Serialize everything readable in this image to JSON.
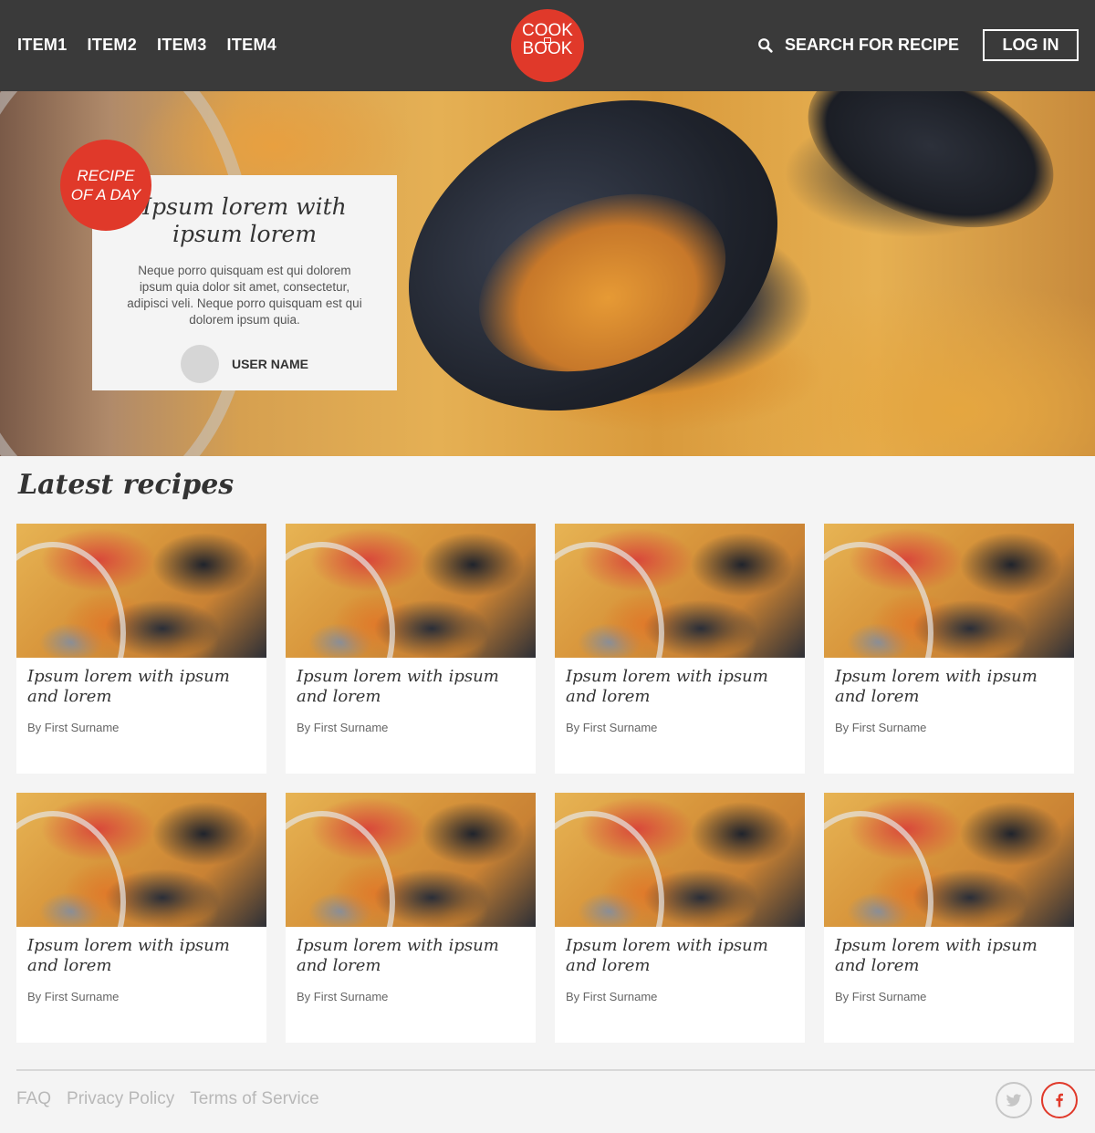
{
  "header": {
    "nav": [
      "ITEM1",
      "ITEM2",
      "ITEM3",
      "ITEM4"
    ],
    "logo_top": "COOK",
    "logo_bottom": "BOOK",
    "search_label": "SEARCH FOR RECIPE",
    "login_label": "LOG IN"
  },
  "hero": {
    "badge_line1": "RECIPE",
    "badge_line2": "OF A DAY",
    "title": "Ipsum lorem with ipsum lorem",
    "description": "Neque porro quisquam est qui dolorem ipsum quia dolor sit amet, consectetur, adipisci veli. Neque porro quisquam est qui dolorem ipsum quia.",
    "user_name": "USER NAME"
  },
  "latest": {
    "heading": "Latest recipes",
    "cards": [
      {
        "title": "Ipsum lorem with ipsum and lorem",
        "author": "By First Surname"
      },
      {
        "title": "Ipsum lorem with ipsum and lorem",
        "author": "By First Surname"
      },
      {
        "title": "Ipsum lorem with ipsum and lorem",
        "author": "By First Surname"
      },
      {
        "title": "Ipsum lorem with ipsum and lorem",
        "author": "By First Surname"
      },
      {
        "title": "Ipsum lorem with ipsum and lorem",
        "author": "By First Surname"
      },
      {
        "title": "Ipsum lorem with ipsum and lorem",
        "author": "By First Surname"
      },
      {
        "title": "Ipsum lorem with ipsum and lorem",
        "author": "By First Surname"
      },
      {
        "title": "Ipsum lorem with ipsum and lorem",
        "author": "By First Surname"
      }
    ]
  },
  "footer": {
    "links": [
      "FAQ",
      "Privacy Policy",
      "Terms of Service"
    ],
    "social_icons": [
      "twitter-icon",
      "facebook-icon"
    ]
  },
  "colors": {
    "brand_red": "#e0392a",
    "header_bg": "#3a3a3a"
  }
}
